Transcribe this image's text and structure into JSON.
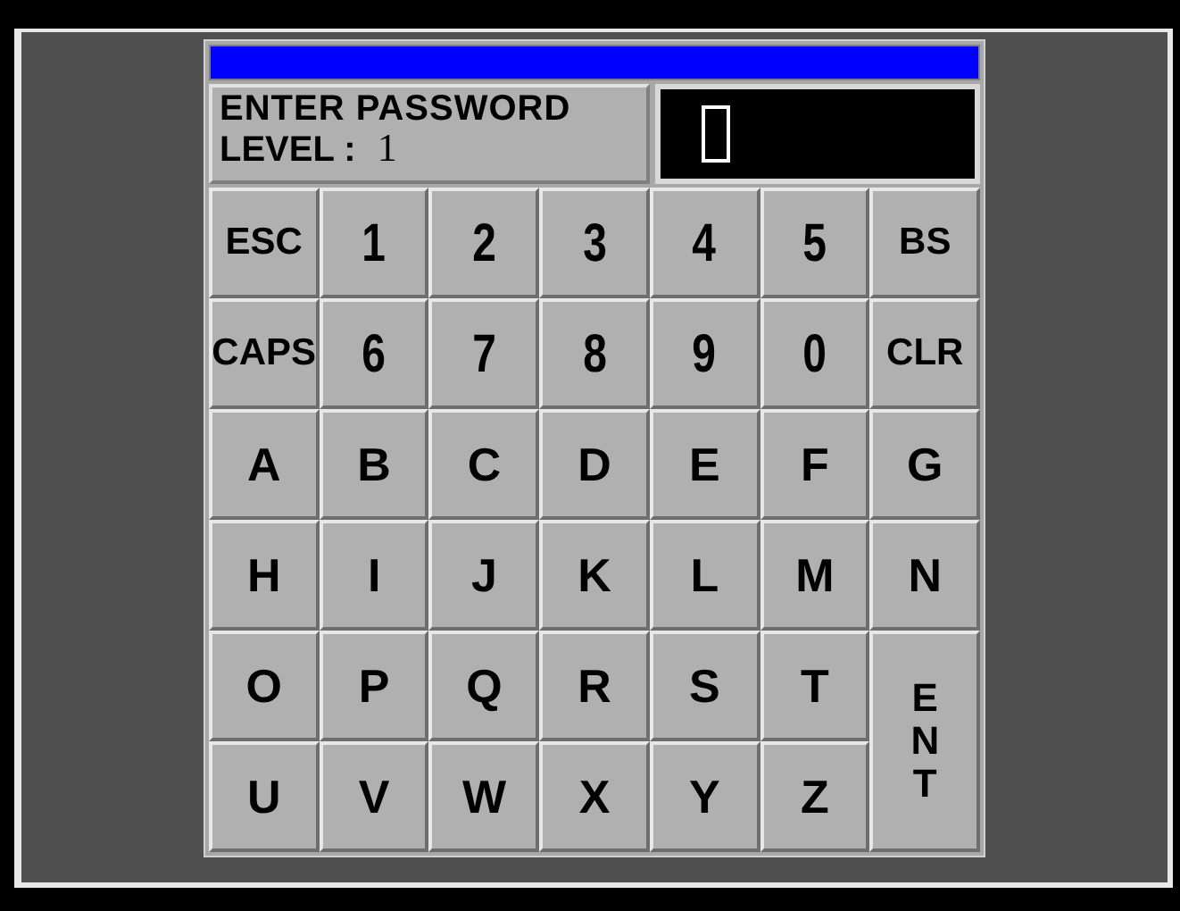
{
  "title_bar": {
    "color": "#0000ff"
  },
  "prompt": {
    "title": "ENTER PASSWORD",
    "level_label": "LEVEL :",
    "level_value": "1"
  },
  "display": {
    "cursor_visible": true
  },
  "keys": [
    {
      "label": "ESC",
      "kind": "word"
    },
    {
      "label": "1",
      "kind": "digit"
    },
    {
      "label": "2",
      "kind": "digit"
    },
    {
      "label": "3",
      "kind": "digit"
    },
    {
      "label": "4",
      "kind": "digit"
    },
    {
      "label": "5",
      "kind": "digit"
    },
    {
      "label": "BS",
      "kind": "word"
    },
    {
      "label": "CAPS",
      "kind": "word"
    },
    {
      "label": "6",
      "kind": "digit"
    },
    {
      "label": "7",
      "kind": "digit"
    },
    {
      "label": "8",
      "kind": "digit"
    },
    {
      "label": "9",
      "kind": "digit"
    },
    {
      "label": "0",
      "kind": "digit"
    },
    {
      "label": "CLR",
      "kind": "word"
    },
    {
      "label": "A",
      "kind": "letter"
    },
    {
      "label": "B",
      "kind": "letter"
    },
    {
      "label": "C",
      "kind": "letter"
    },
    {
      "label": "D",
      "kind": "letter"
    },
    {
      "label": "E",
      "kind": "letter"
    },
    {
      "label": "F",
      "kind": "letter"
    },
    {
      "label": "G",
      "kind": "letter"
    },
    {
      "label": "H",
      "kind": "letter"
    },
    {
      "label": "I",
      "kind": "letter"
    },
    {
      "label": "J",
      "kind": "letter"
    },
    {
      "label": "K",
      "kind": "letter"
    },
    {
      "label": "L",
      "kind": "letter"
    },
    {
      "label": "M",
      "kind": "letter"
    },
    {
      "label": "N",
      "kind": "letter"
    },
    {
      "label": "O",
      "kind": "letter"
    },
    {
      "label": "P",
      "kind": "letter"
    },
    {
      "label": "Q",
      "kind": "letter"
    },
    {
      "label": "R",
      "kind": "letter"
    },
    {
      "label": "S",
      "kind": "letter"
    },
    {
      "label": "T",
      "kind": "letter"
    },
    {
      "label": "ENT",
      "kind": "tall"
    },
    {
      "label": "U",
      "kind": "letter"
    },
    {
      "label": "V",
      "kind": "letter"
    },
    {
      "label": "W",
      "kind": "letter"
    },
    {
      "label": "X",
      "kind": "letter"
    },
    {
      "label": "Y",
      "kind": "letter"
    },
    {
      "label": "Z",
      "kind": "letter"
    }
  ]
}
